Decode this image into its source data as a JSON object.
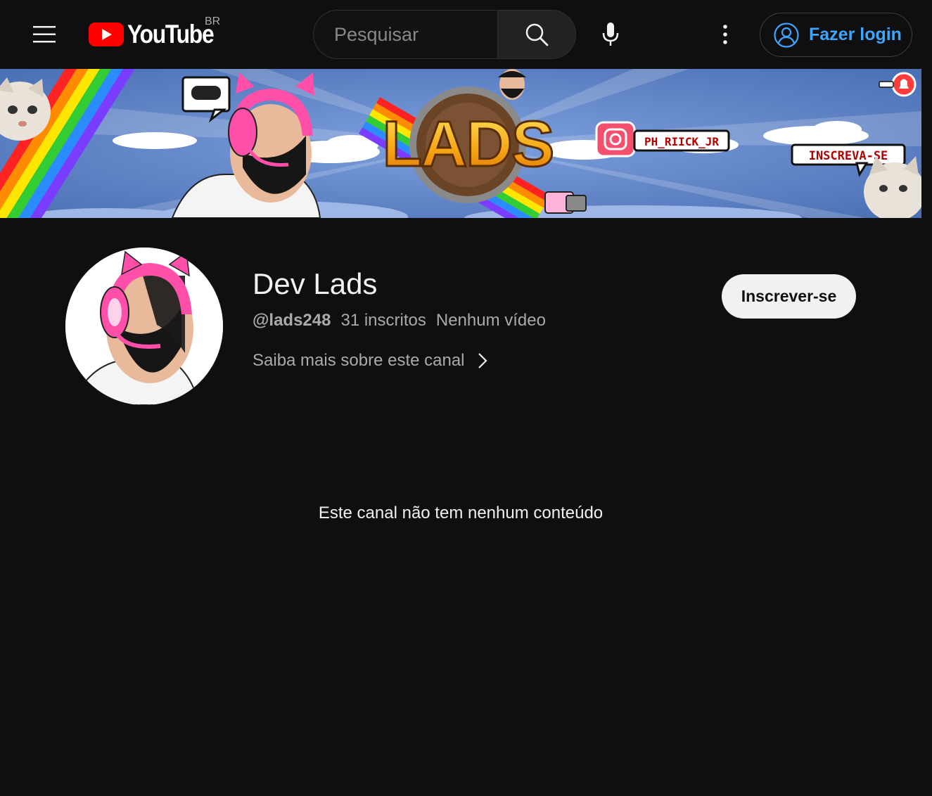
{
  "header": {
    "logo_text": "YouTube",
    "country_code": "BR",
    "search_placeholder": "Pesquisar",
    "login_label": "Fazer login"
  },
  "banner": {
    "title": "LADS",
    "instagram_handle": "PH_RIICK_JR",
    "subscribe_bubble": "INSCREVA-SE"
  },
  "channel": {
    "name": "Dev Lads",
    "handle": "@lads248",
    "subscribers": "31 inscritos",
    "videos": "Nenhum vídeo",
    "about_link": "Saiba mais sobre este canal",
    "subscribe_label": "Inscrever-se"
  },
  "content": {
    "empty_message": "Este canal não tem nenhum conteúdo"
  },
  "colors": {
    "background": "#0f0f0f",
    "brand_red": "#ff0000",
    "link_blue": "#3ea6ff",
    "text_primary": "#f1f1f1",
    "text_secondary": "#aaaaaa"
  },
  "icons": [
    "menu-icon",
    "youtube-logo-icon",
    "search-icon",
    "mic-icon",
    "more-vert-icon",
    "account-icon",
    "chevron-right-icon"
  ]
}
